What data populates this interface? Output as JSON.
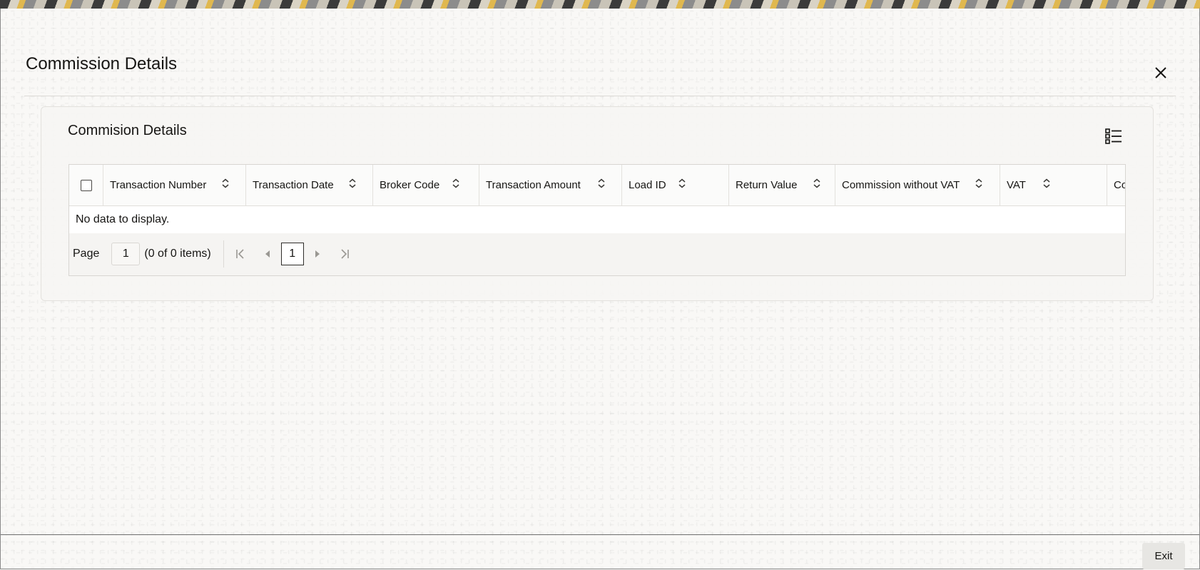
{
  "window": {
    "title": "Commission Details",
    "close_icon": "close-icon"
  },
  "panel": {
    "title": "Commision Details",
    "columns_icon": "column-list-icon"
  },
  "table": {
    "columns": [
      "Transaction Number",
      "Transaction Date",
      "Broker Code",
      "Transaction Amount",
      "Load ID",
      "Return Value",
      "Commission without VAT",
      "VAT",
      "Co"
    ],
    "empty_message": "No data to display."
  },
  "pager": {
    "label": "Page",
    "current_page_input": "1",
    "items_summary": "(0 of 0 items)",
    "current_page": "1"
  },
  "footer": {
    "exit_label": "Exit"
  }
}
